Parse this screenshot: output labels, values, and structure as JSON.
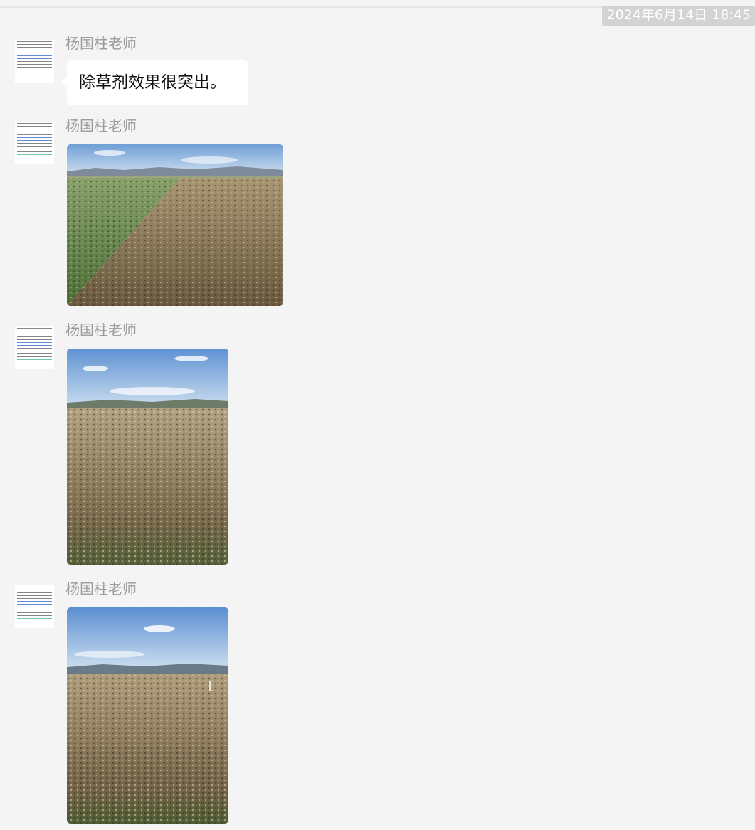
{
  "chat": {
    "timestamp": "2024年6月14日 18:45",
    "messages": [
      {
        "type": "text",
        "sender": "杨国柱老师",
        "text": "除草剂效果很突出。"
      },
      {
        "type": "image",
        "sender": "杨国柱老师",
        "image_alt": "field-comparison-photo"
      },
      {
        "type": "image",
        "sender": "杨国柱老师",
        "image_alt": "sprayed-field-photo"
      },
      {
        "type": "image",
        "sender": "杨国柱老师",
        "image_alt": "sprayed-field-photo"
      }
    ]
  },
  "colors": {
    "background": "#f4f4f4",
    "bubble": "#ffffff",
    "sender_text": "#9b9b9b",
    "timestamp_bg": "#d3d3d3"
  }
}
